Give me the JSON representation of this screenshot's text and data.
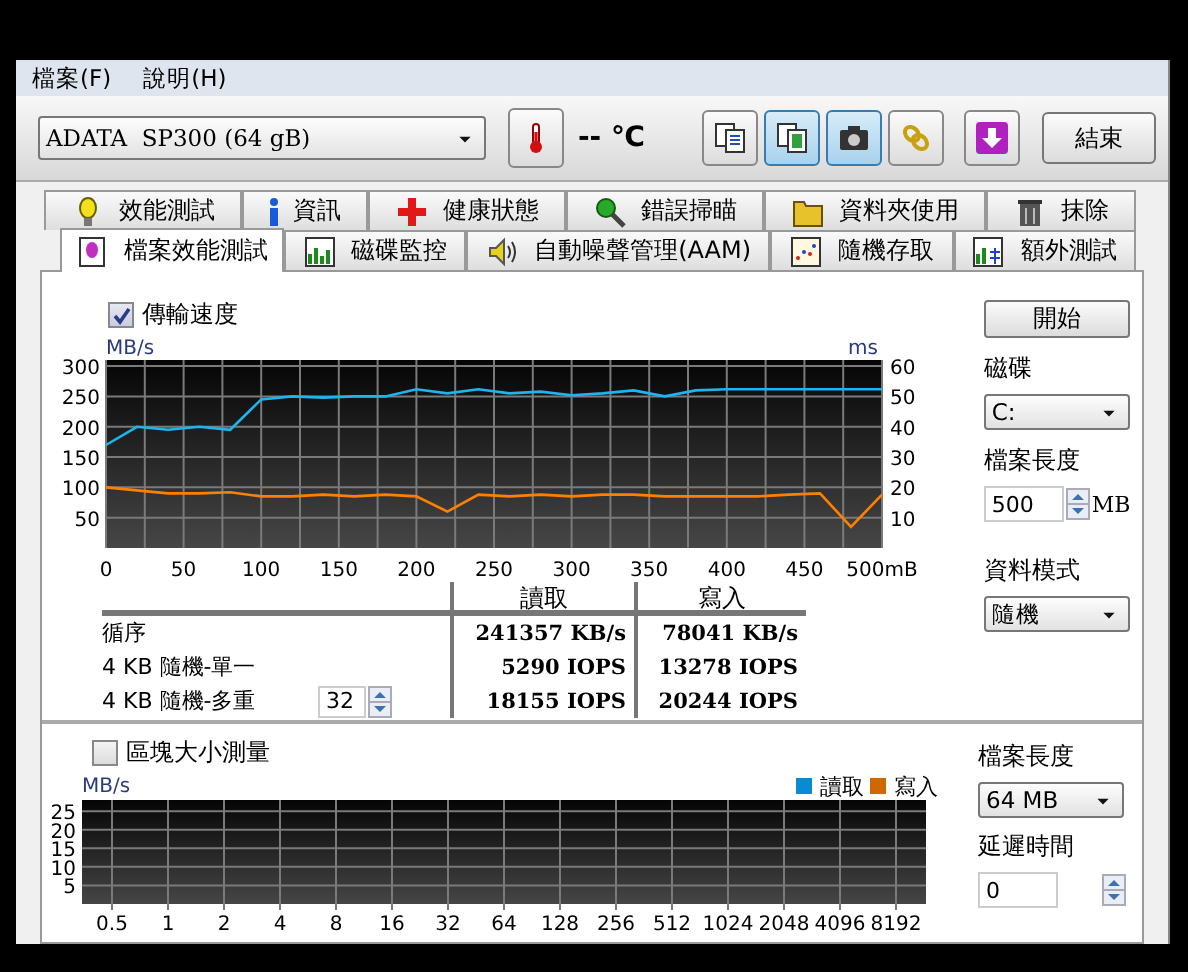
{
  "menu": [
    "檔案(F)",
    "說明(H)"
  ],
  "toolbar": {
    "drive": "ADATA  SP300 (64 gB)",
    "temperature": "-- ℃",
    "buttons": [
      {
        "kind": "copy-text",
        "pressed": false
      },
      {
        "kind": "copy-image",
        "pressed": true
      },
      {
        "kind": "camera",
        "pressed": true
      },
      {
        "kind": "chain",
        "pressed": false
      },
      {
        "kind": "download",
        "pressed": false
      }
    ],
    "exit": "結束"
  },
  "tabs_back": [
    {
      "label": "效能測試",
      "kind": "bulb"
    },
    {
      "label": "資訊",
      "kind": "info"
    },
    {
      "label": "健康狀態",
      "kind": "cross"
    },
    {
      "label": "錯誤掃瞄",
      "kind": "magnifier"
    },
    {
      "label": "資料夾使用",
      "kind": "folder"
    },
    {
      "label": "抹除",
      "kind": "trash"
    }
  ],
  "tabs": [
    {
      "label": "檔案效能測試",
      "kind": "page",
      "selected": true
    },
    {
      "label": "磁碟監控",
      "kind": "bars",
      "selected": false
    },
    {
      "label": "自動噪聲管理(AAM)",
      "kind": "speaker",
      "selected": false
    },
    {
      "label": "隨機存取",
      "kind": "dots",
      "selected": false
    },
    {
      "label": "額外測試",
      "kind": "grid",
      "selected": false
    }
  ],
  "transfer": {
    "label": "傳輸速度",
    "checked": true,
    "chart_data": {
      "type": "line",
      "ylabel": "MB/s",
      "y2label": "ms",
      "x": [
        0,
        20,
        40,
        60,
        80,
        100,
        120,
        140,
        160,
        180,
        200,
        220,
        240,
        260,
        280,
        300,
        320,
        340,
        360,
        380,
        400,
        420,
        440,
        460,
        480,
        500
      ],
      "xlim": [
        0,
        500
      ],
      "ylim": [
        0,
        310
      ],
      "y2lim": [
        0,
        62
      ],
      "grid": true,
      "xticks": [
        0,
        50,
        100,
        150,
        200,
        250,
        300,
        350,
        400,
        450,
        {
          "value": 500,
          "label": "500mB"
        }
      ],
      "yticks": [
        50,
        100,
        150,
        200,
        250,
        300
      ],
      "y2ticks": [
        10,
        20,
        30,
        40,
        50,
        60
      ],
      "series": [
        {
          "color": "#1eb4f0",
          "values": [
            170,
            200,
            195,
            200,
            195,
            245,
            250,
            248,
            250,
            250,
            262,
            255,
            262,
            255,
            258,
            252,
            255,
            260,
            250,
            260,
            262,
            262,
            262,
            262,
            262,
            262
          ]
        },
        {
          "color": "#ff8000",
          "values": [
            100,
            95,
            90,
            90,
            92,
            85,
            85,
            88,
            85,
            88,
            85,
            60,
            88,
            85,
            88,
            85,
            88,
            88,
            85,
            85,
            85,
            85,
            88,
            90,
            35,
            88
          ]
        }
      ]
    }
  },
  "results": {
    "columns": [
      "讀取",
      "寫入"
    ],
    "rows": [
      {
        "label": "循序",
        "read": "241357 KB/s",
        "write": "78041 KB/s"
      },
      {
        "label": "4 KB 隨機-單一",
        "read": "5290 IOPS",
        "write": "13278 IOPS"
      },
      {
        "label": "4 KB 隨機-多重",
        "queue_depth": "32",
        "read": "18155 IOPS",
        "write": "20244 IOPS"
      }
    ]
  },
  "controls": {
    "start": "開始",
    "disk_label": "磁碟",
    "disk": "C:",
    "file_length_label": "檔案長度",
    "file_length": "500",
    "file_length_unit": "MB",
    "data_mode_label": "資料模式",
    "data_mode": "隨機"
  },
  "block": {
    "label": "區塊大小測量",
    "checked": false,
    "chart_data": {
      "type": "bar",
      "ylabel": "MB/s",
      "categories": [
        "0.5",
        "1",
        "2",
        "4",
        "8",
        "16",
        "32",
        "64",
        "128",
        "256",
        "512",
        "1024",
        "2048",
        "4096",
        "8192"
      ],
      "ylim": [
        0,
        28
      ],
      "yticks": [
        5,
        10,
        15,
        20,
        25
      ],
      "grid": true,
      "series": [
        {
          "name": "讀取",
          "color": "#0a8ad0",
          "values": [
            null,
            null,
            null,
            null,
            null,
            null,
            null,
            null,
            null,
            null,
            null,
            null,
            null,
            null,
            null
          ]
        },
        {
          "name": "寫入",
          "color": "#d06800",
          "values": [
            null,
            null,
            null,
            null,
            null,
            null,
            null,
            null,
            null,
            null,
            null,
            null,
            null,
            null,
            null
          ]
        }
      ]
    }
  },
  "block_controls": {
    "file_length_label": "檔案長度",
    "file_length": "64 MB",
    "delay_label": "延遲時間",
    "delay": "0"
  }
}
